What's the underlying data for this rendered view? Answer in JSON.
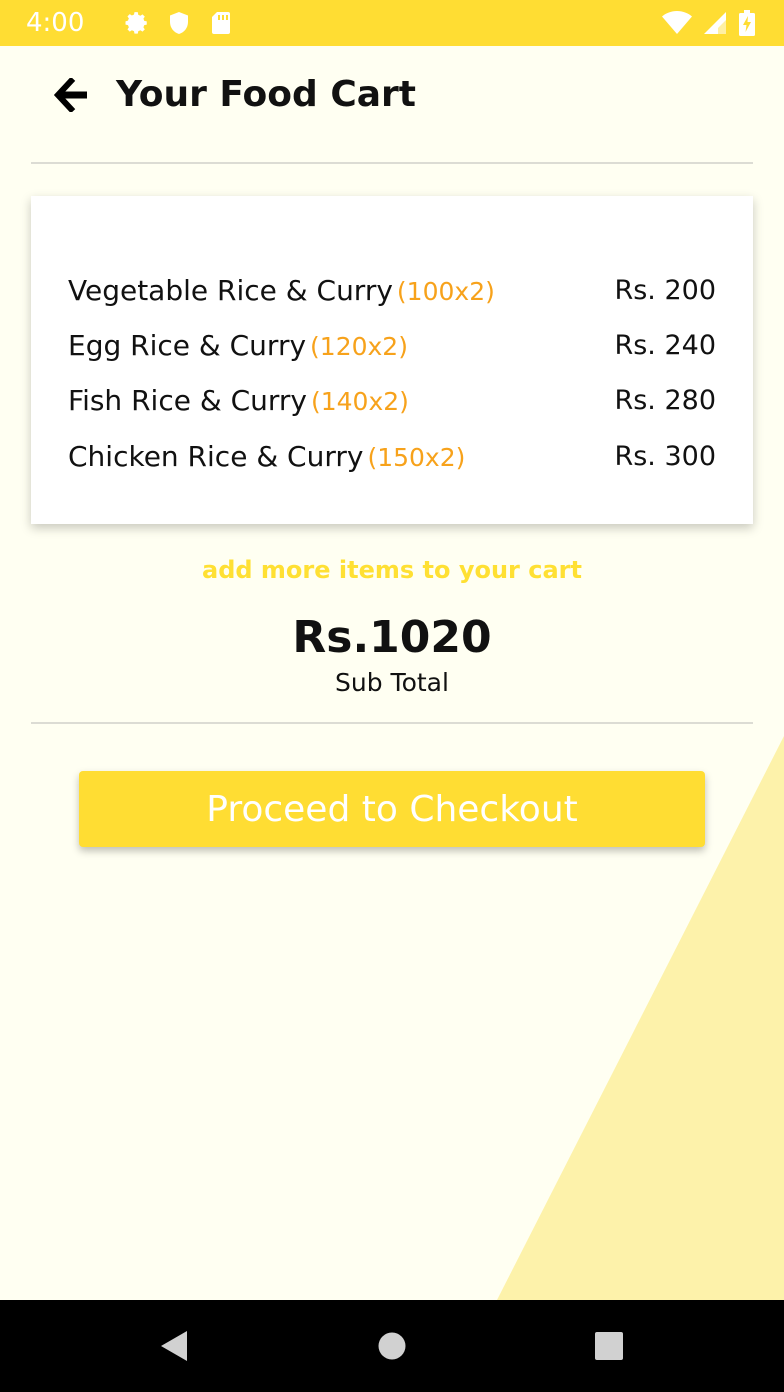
{
  "status_bar": {
    "time": "4:00",
    "left_icons": [
      "gear-icon",
      "shield-icon",
      "sd-card-icon"
    ],
    "right_icons": [
      "wifi-icon",
      "signal-icon",
      "battery-icon"
    ]
  },
  "header": {
    "title": "Your Food Cart",
    "back_icon": "arrow-left-icon"
  },
  "cart": {
    "items": [
      {
        "name": "Vegetable Rice & Curry",
        "qty": "(100x2)",
        "price": "Rs. 200"
      },
      {
        "name": "Egg Rice & Curry",
        "qty": "(120x2)",
        "price": "Rs. 240"
      },
      {
        "name": "Fish Rice & Curry",
        "qty": "(140x2)",
        "price": "Rs. 280"
      },
      {
        "name": "Chicken Rice & Curry",
        "qty": "(150x2)",
        "price": "Rs. 300"
      }
    ]
  },
  "add_more_label": "add more items to your cart",
  "subtotal": {
    "value": "Rs.1020",
    "label": "Sub Total"
  },
  "checkout_label": "Proceed to Checkout",
  "nav_bar": {
    "icons": [
      "back-triangle-icon",
      "home-circle-icon",
      "recents-square-icon"
    ]
  },
  "colors": {
    "accent": "#FFDD33",
    "background": "#FFFFF2",
    "quantity": "#F7A21B",
    "triangle": "#FDF2AA"
  }
}
